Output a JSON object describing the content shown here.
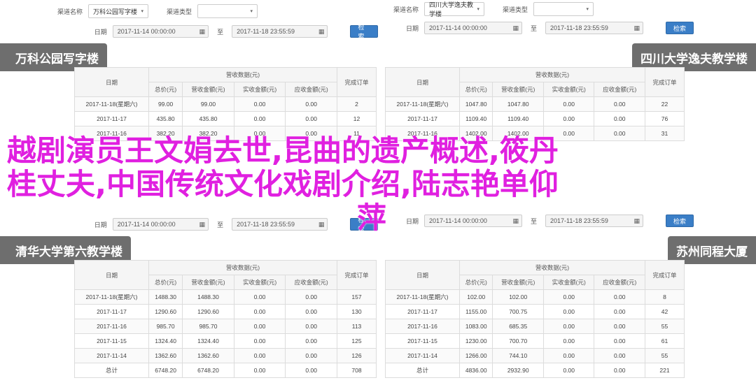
{
  "panels": {
    "tl": {
      "label_channel": "渠道名称",
      "channel_value": "万科公园写字楼",
      "label_type": "渠道类型",
      "type_value": "",
      "label_date": "日期",
      "date_from": "2017-11-14 00:00:00",
      "to": "至",
      "date_to": "2017-11-18 23:55:59",
      "query": "检索",
      "tag": "万科公园写字楼",
      "th_date": "日期",
      "th_group": "营收数据(元)",
      "th_cols": [
        "总价(元)",
        "营收金额(元)",
        "实收金额(元)",
        "应收金额(元)",
        "完成订单"
      ],
      "rows": [
        [
          "2017-11-18(星期六)",
          "99.00",
          "99.00",
          "0.00",
          "0.00",
          "2"
        ],
        [
          "2017-11-17",
          "435.80",
          "435.80",
          "0.00",
          "0.00",
          "12"
        ],
        [
          "2017-11-16",
          "382.20",
          "382.20",
          "0.00",
          "0.00",
          "11"
        ]
      ]
    },
    "tr": {
      "label_channel": "渠道名称",
      "channel_value": "四川大学逸夫教学楼",
      "label_type": "渠道类型",
      "type_value": "",
      "label_date": "日期",
      "date_from": "2017-11-14 00:00:00",
      "to": "至",
      "date_to": "2017-11-18 23:55:59",
      "query": "检索",
      "tag": "四川大学逸夫教学楼",
      "th_date": "日期",
      "th_group": "营收数据(元)",
      "th_cols": [
        "总价(元)",
        "营收金额(元)",
        "实收金额(元)",
        "应收金额(元)",
        "完成订单"
      ],
      "rows": [
        [
          "2017-11-18(星期六)",
          "1047.80",
          "1047.80",
          "0.00",
          "0.00",
          "22"
        ],
        [
          "2017-11-17",
          "1109.40",
          "1109.40",
          "0.00",
          "0.00",
          "76"
        ],
        [
          "2017-11-16",
          "1402.00",
          "1402.00",
          "0.00",
          "0.00",
          "31"
        ]
      ]
    },
    "bl": {
      "label_date": "日期",
      "date_from": "2017-11-14 00:00:00",
      "to": "至",
      "date_to": "2017-11-18 23:55:59",
      "query": "检索",
      "tag": "清华大学第六教学楼",
      "th_date": "日期",
      "th_group": "营收数据(元)",
      "th_cols": [
        "总价(元)",
        "营收金额(元)",
        "实收金额(元)",
        "应收金额(元)",
        "完成订单"
      ],
      "rows": [
        [
          "2017-11-18(星期六)",
          "1488.30",
          "1488.30",
          "0.00",
          "0.00",
          "157"
        ],
        [
          "2017-11-17",
          "1290.60",
          "1290.60",
          "0.00",
          "0.00",
          "130"
        ],
        [
          "2017-11-16",
          "985.70",
          "985.70",
          "0.00",
          "0.00",
          "113"
        ],
        [
          "2017-11-15",
          "1324.40",
          "1324.40",
          "0.00",
          "0.00",
          "125"
        ],
        [
          "2017-11-14",
          "1362.60",
          "1362.60",
          "0.00",
          "0.00",
          "126"
        ],
        [
          "总计",
          "6748.20",
          "6748.20",
          "0.00",
          "0.00",
          "708"
        ]
      ]
    },
    "br": {
      "label_date": "日期",
      "date_from": "2017-11-14 00:00:00",
      "to": "至",
      "date_to": "2017-11-18 23:55:59",
      "query": "检索",
      "tag": "苏州同程大厦",
      "th_date": "日期",
      "th_group": "营收数据(元)",
      "th_cols": [
        "总价(元)",
        "营收金额(元)",
        "实收金额(元)",
        "应收金额(元)",
        "完成订单"
      ],
      "rows": [
        [
          "2017-11-18(星期六)",
          "102.00",
          "102.00",
          "0.00",
          "0.00",
          "8"
        ],
        [
          "2017-11-17",
          "1155.00",
          "700.75",
          "0.00",
          "0.00",
          "42"
        ],
        [
          "2017-11-16",
          "1083.00",
          "685.35",
          "0.00",
          "0.00",
          "55"
        ],
        [
          "2017-11-15",
          "1230.00",
          "700.70",
          "0.00",
          "0.00",
          "61"
        ],
        [
          "2017-11-14",
          "1266.00",
          "744.10",
          "0.00",
          "0.00",
          "55"
        ],
        [
          "总计",
          "4836.00",
          "2932.90",
          "0.00",
          "0.00",
          "221"
        ]
      ]
    }
  },
  "headline": {
    "line1": "越剧演员王文娟去世,昆曲的遗产概述,筱丹",
    "line2": "桂丈夫,中国传统文化戏剧介绍,陆志艳单仰",
    "line3": "萍"
  },
  "colors": {
    "headline": "#e020e0",
    "tag_bg": "#6e6e6e",
    "query_button": "#3a7ec7",
    "table_header_bg": "#f5f5f5",
    "border": "#dcdcdc"
  },
  "icons": {
    "calendar": "calendar-icon",
    "caret": "chevron-down-icon"
  }
}
